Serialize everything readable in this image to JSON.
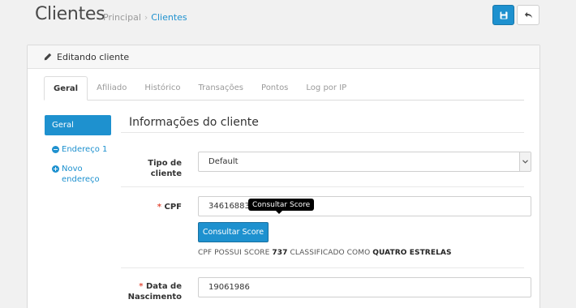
{
  "header": {
    "title": "Clientes",
    "breadcrumb": [
      {
        "label": "Principal"
      },
      {
        "label": "Clientes"
      }
    ],
    "breadcrumb_separator": "›",
    "save_icon": "floppy-disk-icon",
    "back_icon": "reply-arrow-icon"
  },
  "panel": {
    "heading": "Editando cliente",
    "heading_icon": "pencil-icon"
  },
  "tabs": [
    {
      "label": "Geral",
      "active": true
    },
    {
      "label": "Afiliado"
    },
    {
      "label": "Histórico"
    },
    {
      "label": "Transações"
    },
    {
      "label": "Pontos"
    },
    {
      "label": "Log por IP"
    }
  ],
  "sidebar": {
    "active_item": "Geral",
    "items": [
      {
        "label": "Endereço 1",
        "icon": "minus-circle-icon"
      },
      {
        "label": "Novo endereço",
        "icon": "plus-circle-icon"
      }
    ]
  },
  "form": {
    "section_title": "Informações do cliente",
    "customer_type": {
      "label_line1": "Tipo de",
      "label_line2": "cliente",
      "value": "Default"
    },
    "cpf": {
      "required_mark": "*",
      "label": "CPF",
      "value": "3461688380"
    },
    "tooltip": "Consultar Score",
    "score_button": "Consultar Score",
    "score_text": {
      "prefix": "CPF POSSUI SCORE",
      "score": "737",
      "middle": "CLASSIFICADO COMO",
      "rating": "QUATRO ESTRELAS"
    },
    "birth_date": {
      "required_mark": "*",
      "label_line1": "Data de",
      "label_line2": "Nascimento",
      "value": "19061986"
    }
  },
  "colors": {
    "primary": "#1e91cf",
    "required": "#e3503e",
    "background": "#f1f1f1"
  }
}
